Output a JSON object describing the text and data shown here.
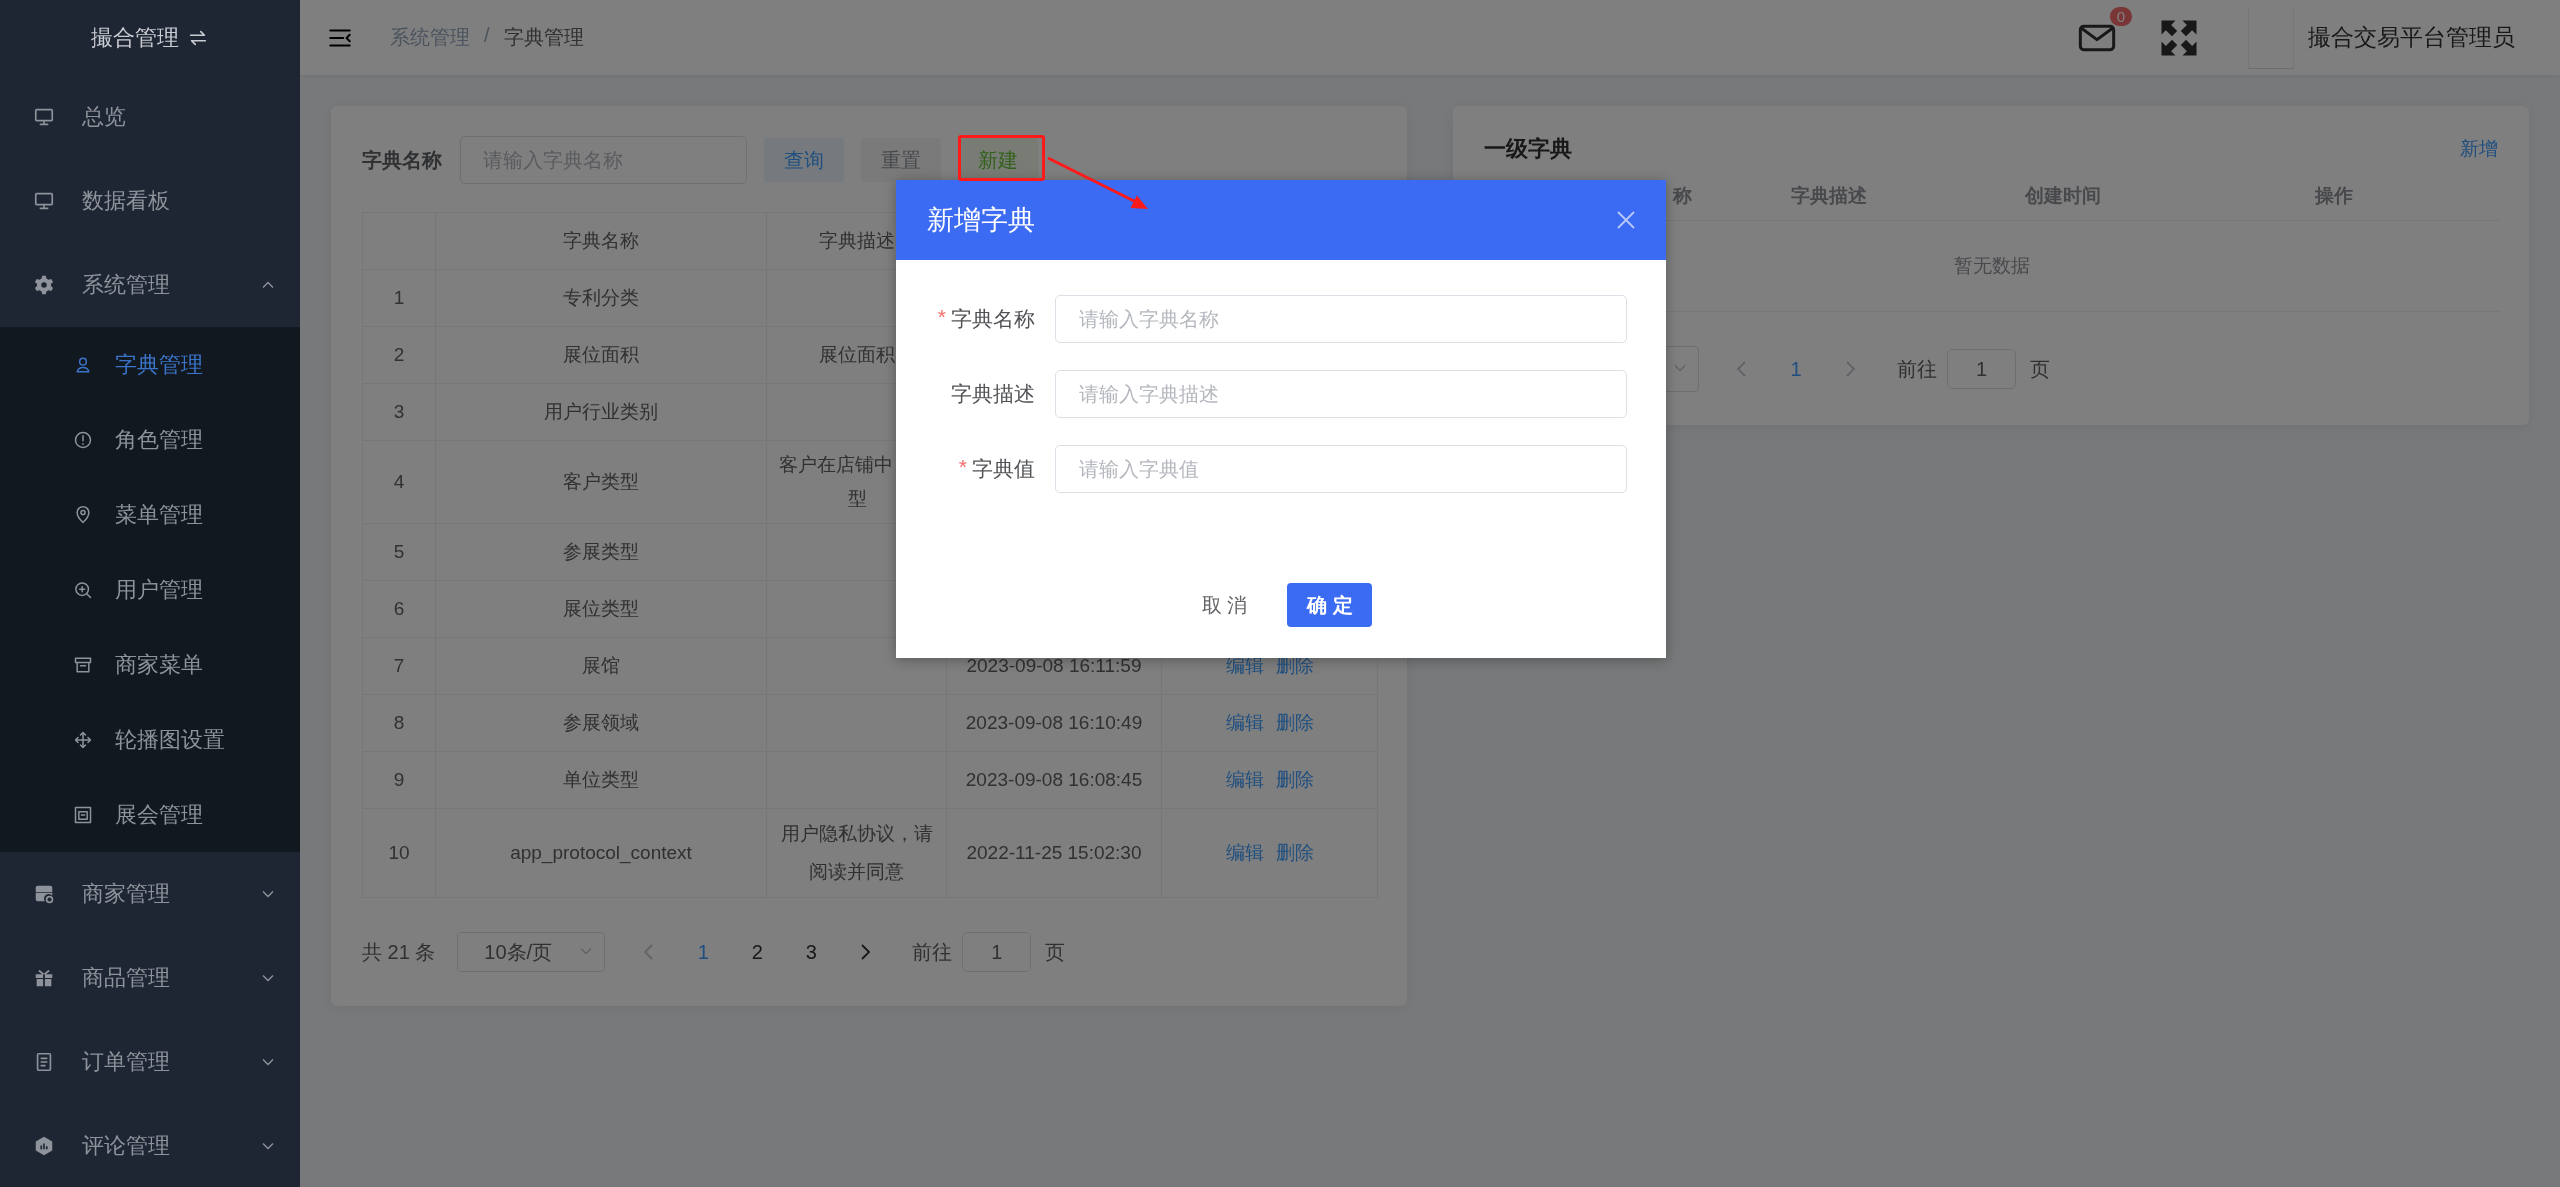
{
  "sidebar": {
    "title": "撮合管理",
    "items": [
      {
        "label": "总览",
        "selected": false
      },
      {
        "label": "数据看板",
        "selected": false
      },
      {
        "label": "系统管理",
        "selected": false,
        "expanded": true,
        "children": [
          {
            "label": "字典管理",
            "selected": true
          },
          {
            "label": "角色管理",
            "selected": false
          },
          {
            "label": "菜单管理",
            "selected": false
          },
          {
            "label": "用户管理",
            "selected": false
          },
          {
            "label": "商家菜单",
            "selected": false
          },
          {
            "label": "轮播图设置",
            "selected": false
          },
          {
            "label": "展会管理",
            "selected": false
          }
        ]
      },
      {
        "label": "商家管理",
        "selected": false,
        "expanded": false
      },
      {
        "label": "商品管理",
        "selected": false,
        "expanded": false
      },
      {
        "label": "订单管理",
        "selected": false,
        "expanded": false
      },
      {
        "label": "评论管理",
        "selected": false,
        "expanded": false
      }
    ]
  },
  "header": {
    "breadcrumb": {
      "items": [
        "系统管理",
        "字典管理"
      ],
      "separator": "/"
    },
    "mail_badge": "0",
    "user_name": "撮合交易平台管理员"
  },
  "dict_list": {
    "search_label": "字典名称",
    "search_placeholder": "请输入字典名称",
    "buttons": [
      {
        "label": "查询",
        "kind": "primary"
      },
      {
        "label": "重置",
        "kind": "info"
      },
      {
        "label": "新建",
        "kind": "success"
      }
    ],
    "table": {
      "columns": [
        "",
        "字典名称",
        "字典描述"
      ],
      "rows": [
        {
          "index": "1",
          "name": "专利分类"
        },
        {
          "index": "2",
          "name": "展位面积",
          "description": "展位面积"
        },
        {
          "index": "3",
          "name": "用户行业类别"
        },
        {
          "index": "4",
          "name": "客户类型",
          "description_lines": [
            "客户在店铺中",
            "型"
          ]
        },
        {
          "index": "5",
          "name": "参展类型"
        },
        {
          "index": "6",
          "name": "展位类型"
        },
        {
          "index": "7",
          "name": "展馆",
          "created": "2023-09-08 16:11:59",
          "actions": [
            "编辑",
            "删除"
          ]
        },
        {
          "index": "8",
          "name": "参展领域",
          "created": "2023-09-08 16:10:49",
          "actions": [
            "编辑",
            "删除"
          ]
        },
        {
          "index": "9",
          "name": "单位类型",
          "created": "2023-09-08 16:08:45",
          "actions": [
            "编辑",
            "删除"
          ]
        },
        {
          "index": "10",
          "name": "app_protocol_context",
          "description": "用户隐私协议，请阅读并同意",
          "created": "2022-11-25 15:02:30",
          "actions": [
            "编辑",
            "删除"
          ]
        }
      ]
    },
    "pagination": {
      "total": "共 21 条",
      "page_size": "10条/页",
      "pages": [
        {
          "label": "1",
          "selected": true
        },
        {
          "label": "2",
          "selected": false
        },
        {
          "label": "3",
          "selected": false
        }
      ],
      "goto_label": "前往",
      "goto_value": "1",
      "goto_suffix": "页"
    }
  },
  "level1_dict": {
    "title": "一级字典",
    "add_link": "新增",
    "columns": [
      "称",
      "字典描述",
      "创建时间",
      "操作"
    ],
    "empty_text": "暂无数据",
    "pagination": {
      "pages": [
        {
          "label": "1",
          "selected": true
        }
      ],
      "goto_label": "前往",
      "goto_value": "1",
      "goto_suffix": "页"
    }
  },
  "dialog": {
    "title": "新增字典",
    "fields": [
      {
        "required_mark": "*",
        "label": "字典名称",
        "placeholder": "请输入字典名称"
      },
      {
        "label": "字典描述",
        "placeholder": "请输入字典描述"
      },
      {
        "required_mark": "*",
        "label": "字典值",
        "placeholder": "请输入字典值"
      }
    ],
    "buttons": [
      {
        "label": "取 消",
        "kind": "text"
      },
      {
        "label": "确 定",
        "kind": "primary"
      }
    ]
  }
}
